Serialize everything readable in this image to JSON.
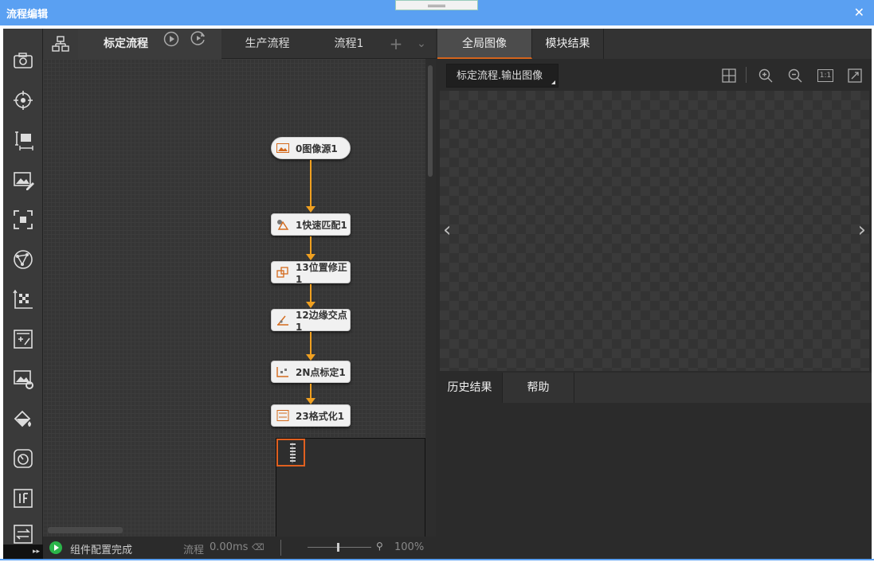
{
  "window": {
    "title": "流程编辑",
    "close_label": "✕"
  },
  "toolbox": {
    "icons": [
      "camera-icon",
      "target-icon",
      "measure-icon",
      "image-edit-icon",
      "locate-icon",
      "geometry-icon",
      "calibration-icon",
      "calculator-icon",
      "image-process-icon",
      "color-fill-icon",
      "logic-icon",
      "if-icon",
      "switch-icon"
    ],
    "expand_label": "▸▸"
  },
  "flow": {
    "tabs": [
      {
        "label": "标定流程",
        "active": true
      },
      {
        "label": "生产流程"
      },
      {
        "label": "流程1"
      }
    ],
    "add_label": "+",
    "more_label": "⌄",
    "nodes": [
      {
        "label": "0图像源1",
        "icon": "image-source-icon"
      },
      {
        "label": "1快速匹配1",
        "icon": "fast-match-icon"
      },
      {
        "label": "13位置修正1",
        "icon": "position-fix-icon"
      },
      {
        "label": "12边缘交点1",
        "icon": "edge-intersection-icon"
      },
      {
        "label": "2N点标定1",
        "icon": "n-point-calibration-icon"
      },
      {
        "label": "23格式化1",
        "icon": "format-icon"
      }
    ],
    "status": {
      "message": "组件配置完成",
      "flow_label": "流程",
      "time": "0.00ms",
      "zoom": "100%"
    }
  },
  "right": {
    "tabs": [
      {
        "label": "全局图像",
        "active": true
      },
      {
        "label": "模块结果"
      }
    ],
    "image_select": "标定流程.输出图像",
    "bottom_tabs": [
      {
        "label": "历史结果"
      },
      {
        "label": "帮助"
      }
    ],
    "zoom_fit_label": "1:1"
  }
}
